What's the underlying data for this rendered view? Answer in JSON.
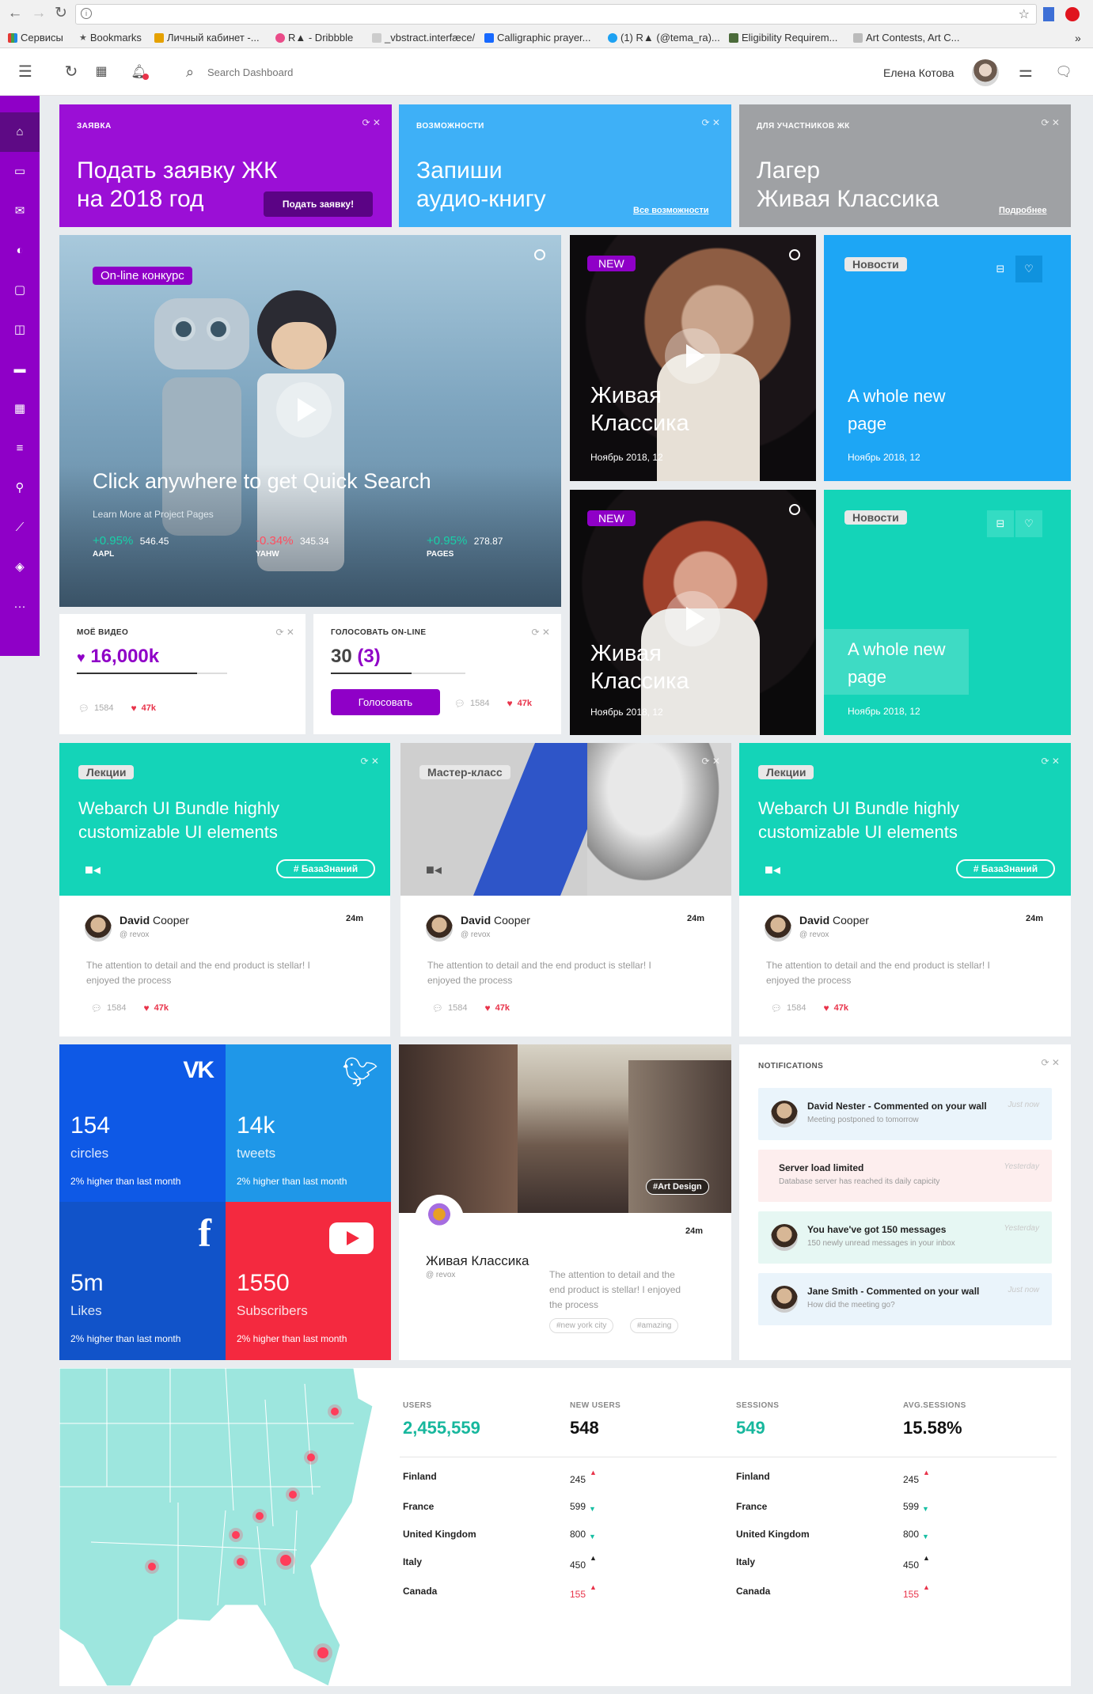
{
  "browser": {
    "bookmarks": [
      "Сервисы",
      "Bookmarks",
      "Личный кабинет -...",
      "R▲ - Dribbble",
      "_vbstract.interfæce/",
      "Calligraphic prayer...",
      "(1) R▲ (@tema_ra)...",
      "Eligibility Requirem...",
      "Art Contests, Art C..."
    ]
  },
  "header": {
    "search_placeholder": "Search Dashboard",
    "user_name": "Елена Котова"
  },
  "top_cards": [
    {
      "label": "ЗАЯВКА",
      "title_line1": "Подать заявку ЖК",
      "title_line2": "на 2018 год",
      "button": "Подать заявку!",
      "color": "#9b0fd6"
    },
    {
      "label": "ВОЗМОЖНОСТИ",
      "title_line1": "Запиши",
      "title_line2": "аудио-книгу",
      "link": "Все возможности",
      "color": "#3eb0f7"
    },
    {
      "label": "ДЛЯ УЧАСТНИКОВ ЖК",
      "title_line1": "Лагер",
      "title_line2": "Живая Классика",
      "link": "Подробнее",
      "color": "#9fa1a4"
    }
  ],
  "hero": {
    "badge": "On-line конкурс",
    "title": "Click anywhere to get Quick Search",
    "subtitle": "Learn More at Project Pages",
    "tickers": [
      {
        "change": "+0.95%",
        "value": "546.45",
        "name": "AAPL",
        "dir": "up"
      },
      {
        "change": "-0.34%",
        "value": "345.34",
        "name": "YAHW",
        "dir": "down"
      },
      {
        "change": "+0.95%",
        "value": "278.87",
        "name": "PAGES",
        "dir": "up"
      }
    ]
  },
  "video_cards": [
    {
      "badge": "NEW",
      "title_line1": "Живая",
      "title_line2": "Классика",
      "date": "Ноябрь 2018, 12"
    },
    {
      "badge": "NEW",
      "title_line1": "Живая",
      "title_line2": "Классика",
      "date": "Ноябрь 2018, 12"
    }
  ],
  "news_cards": [
    {
      "badge": "Новости",
      "title_line1": "A whole new",
      "title_line2": "page",
      "date": "Ноябрь 2018, 12",
      "color": "#1da6f5"
    },
    {
      "badge": "Новости",
      "title_line1": "A whole new",
      "title_line2": "page",
      "date": "Ноябрь 2018, 12",
      "color": "#14d4b8"
    }
  ],
  "my_video": {
    "label": "МОЁ ВИДЕО",
    "value": "16,000k",
    "comments": "1584",
    "likes": "47k",
    "progress": 0.8
  },
  "vote": {
    "label": "ГОЛОСОВАТЬ ON-LINE",
    "value": "30",
    "value_paren": "(3)",
    "button": "Голосовать",
    "comments": "1584",
    "likes": "47k",
    "progress": 0.6
  },
  "lecture_cards": [
    {
      "badge": "Лекции",
      "title_line1": "Webarch UI Bundle highly",
      "title_line2": "customizable UI elements",
      "hashtag": "# БазаЗнаний",
      "author_first": "David",
      "author_last": "Cooper",
      "handle": "@ revox",
      "time": "24m",
      "text_line1": "The attention to detail and the end product is stellar! I",
      "text_line2": "enjoyed the process",
      "comments": "1584",
      "likes": "47k"
    },
    {
      "badge": "Мастер-класс",
      "author_first": "David",
      "author_last": "Cooper",
      "handle": "@ revox",
      "time": "24m",
      "text_line1": "The attention to detail and the end product is stellar! I",
      "text_line2": "enjoyed the process",
      "comments": "1584",
      "likes": "47k"
    },
    {
      "badge": "Лекции",
      "title_line1": "Webarch UI Bundle highly",
      "title_line2": "customizable UI elements",
      "hashtag": "# БазаЗнаний",
      "author_first": "David",
      "author_last": "Cooper",
      "handle": "@ revox",
      "time": "24m",
      "text_line1": "The attention to detail and the end product is stellar! I",
      "text_line2": "enjoyed the process",
      "comments": "1584",
      "likes": "47k"
    }
  ],
  "social": [
    {
      "icon": "vk-icon",
      "value": "154",
      "label": "circles",
      "note": "2% higher than last month",
      "color": "#0e59e6"
    },
    {
      "icon": "twitter-icon",
      "value": "14k",
      "label": "tweets",
      "note": "2% higher than last month",
      "color": "#1f97e8"
    },
    {
      "icon": "facebook-icon",
      "value": "5m",
      "label": "Likes",
      "note": "2% higher than last month",
      "color": "#1153c9"
    },
    {
      "icon": "youtube-icon",
      "value": "1550",
      "label": "Subscribers",
      "note": "2% higher than last month",
      "color": "#f4293f"
    }
  ],
  "photo_post": {
    "tag": "#Art Design",
    "time": "24m",
    "name": "Живая Классика",
    "handle": "@ revox",
    "text_line1": "The attention to detail and the",
    "text_line2": "end product is stellar! I enjoyed",
    "text_line3": "the process",
    "tags": [
      "#new york city",
      "#amazing"
    ]
  },
  "notifications": {
    "title": "NOTIFICATIONS",
    "items": [
      {
        "title": "David Nester - Commented on your wall",
        "sub": "Meeting postponed to tomorrow",
        "time": "Just now",
        "bg": "#eaf4fb",
        "avatar": true
      },
      {
        "title": "Server load limited",
        "sub": "Database server has reached its daily capicity",
        "time": "Yesterday",
        "bg": "#fdeeee",
        "avatar": false
      },
      {
        "title": "You have've got 150 messages",
        "sub": "150 newly unread messages in your inbox",
        "time": "Yesterday",
        "bg": "#e6f7f3",
        "avatar": true
      },
      {
        "title": "Jane Smith - Commented on your wall",
        "sub": "How did the meeting go?",
        "time": "Just now",
        "bg": "#eaf4fb",
        "avatar": true
      }
    ]
  },
  "analytics": {
    "stats": [
      {
        "label": "USERS",
        "value": "2,455,559",
        "color": "#17b79d"
      },
      {
        "label": "NEW USERS",
        "value": "548",
        "color": "#111"
      },
      {
        "label": "SESSIONS",
        "value": "549",
        "color": "#17b79d"
      },
      {
        "label": "AVG.SESSIONS",
        "value": "15.58%",
        "color": "#111"
      }
    ],
    "rows": [
      {
        "country": "Finland",
        "value": "245",
        "dir": "up",
        "red": false
      },
      {
        "country": "France",
        "value": "599",
        "dir": "down",
        "red": false
      },
      {
        "country": "United Kingdom",
        "value": "800",
        "dir": "down",
        "red": false
      },
      {
        "country": "Italy",
        "value": "450",
        "dir": "up-dark",
        "red": false
      },
      {
        "country": "Canada",
        "value": "155",
        "dir": "up",
        "red": true
      }
    ]
  }
}
